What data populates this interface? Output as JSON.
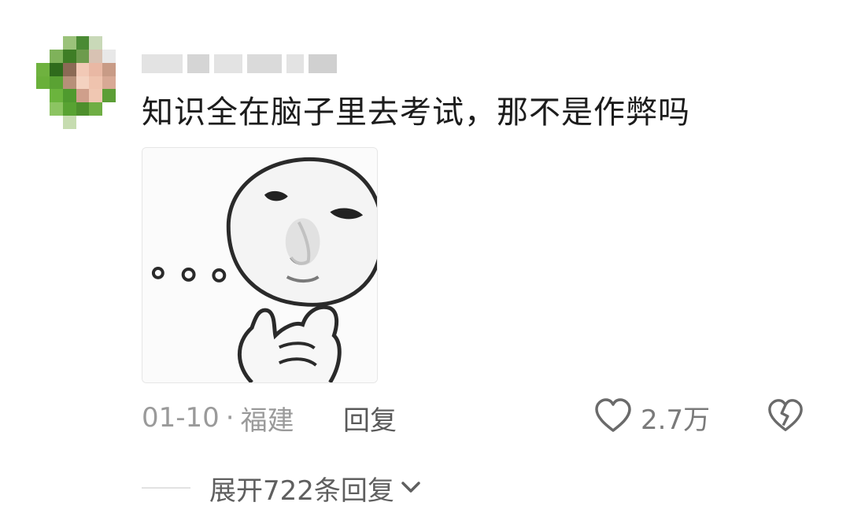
{
  "comment": {
    "text": "知识全在脑子里去考试，那不是作弊吗",
    "date": "01-10",
    "separator": "·",
    "location": "福建",
    "reply_label": "回复",
    "like_count": "2.7万",
    "expand_label": "展开722条回复"
  },
  "icons": {
    "like": "heart-outline-icon",
    "dislike": "broken-heart-icon",
    "expand": "chevron-down-icon"
  },
  "colors": {
    "text": "#1c1c1c",
    "meta": "#9a9a9a",
    "action": "#5a5a5a"
  }
}
